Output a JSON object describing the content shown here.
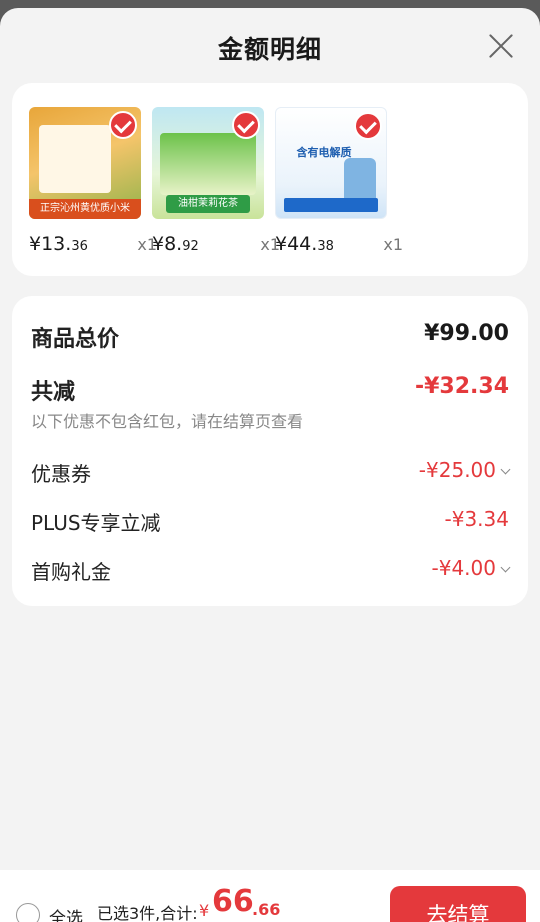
{
  "sheet": {
    "title": "金额明细"
  },
  "products": [
    {
      "name": "正宗沁州黄优质小米",
      "price_int": "¥13.",
      "price_dec": "36",
      "qty": "x1"
    },
    {
      "name": "油柑茉莉花茶",
      "price_int": "¥8.",
      "price_dec": "92",
      "qty": "x1"
    },
    {
      "name": "含有电解质",
      "price_int": "¥44.",
      "price_dec": "38",
      "qty": "x1"
    }
  ],
  "summary": {
    "goods_total_label": "商品总价",
    "goods_total_value": "¥99.00",
    "reduction_label": "共减",
    "reduction_value": "-¥32.34",
    "note": "以下优惠不包含红包，请在结算页查看",
    "coupon_label": "优惠券",
    "coupon_value": "-¥25.00",
    "plus_label": "PLUS专享立减",
    "plus_value": "-¥3.34",
    "first_label": "首购礼金",
    "first_value": "-¥4.00"
  },
  "footer": {
    "select_all": "全选",
    "selected_text": "已选3件,合计:",
    "total_symbol": "¥",
    "total_int": "66",
    "total_dec": ".66",
    "checkout": "去结算"
  },
  "colors": {
    "accent": "#e4393c",
    "text": "#1a1a1a",
    "muted": "#888888"
  }
}
